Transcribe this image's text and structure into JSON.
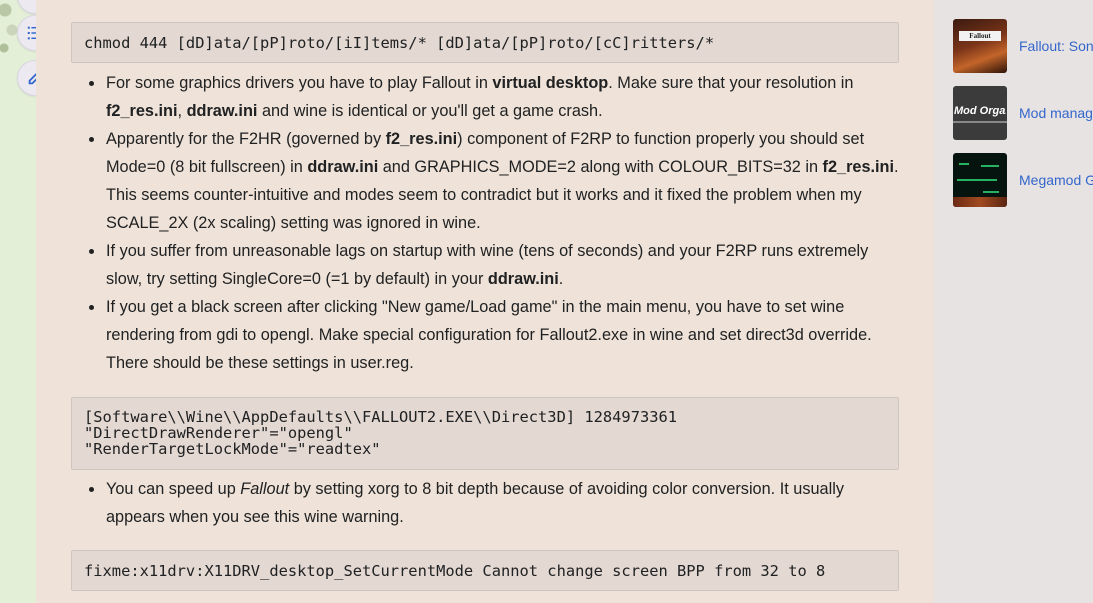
{
  "sidebar_buttons": [
    {
      "name": "toc",
      "icon": "list-icon"
    },
    {
      "name": "edit",
      "icon": "pencil-icon"
    }
  ],
  "code_blocks": {
    "chmod": "chmod 444 [dD]ata/[pP]roto/[iI]tems/* [dD]ata/[pP]roto/[cC]ritters/*",
    "registry_lines": [
      "[Software\\\\Wine\\\\AppDefaults\\\\FALLOUT2.EXE\\\\Direct3D] 1284973361",
      "\"DirectDrawRenderer\"=\"opengl\"",
      "\"RenderTargetLockMode\"=\"readtex\""
    ],
    "fixme": "fixme:x11drv:X11DRV_desktop_SetCurrentMode Cannot change screen BPP from 32 to 8"
  },
  "bullets": {
    "b1": {
      "t1": "For some graphics drivers you have to play Fallout in ",
      "b1": "virtual desktop",
      "t2": ". Make sure that your resolution in ",
      "b2": "f2_res.ini",
      "t3": ", ",
      "b3": "ddraw.ini",
      "t4": " and wine is identical or you'll get a game crash."
    },
    "b2": {
      "t1": "Apparently for the F2HR (governed by ",
      "b1": "f2_res.ini",
      "t2": ") component of F2RP to function properly you should set Mode=0 (8 bit fullscreen) in ",
      "b2": "ddraw.ini",
      "t3": " and GRAPHICS_MODE=2 along with COLOUR_BITS=32 in ",
      "b3": "f2_res.ini",
      "t4": ". This seems counter-intuitive and modes seem to contradict but it works and it fixed the problem when my SCALE_2X (2x scaling) setting was ignored in wine."
    },
    "b3": {
      "t1": "If you suffer from unreasonable lags on startup with wine (tens of seconds) and your F2RP runs extremely slow, try setting SingleCore=0 (=1 by default) in your ",
      "b1": "ddraw.ini",
      "t2": "."
    },
    "b4": {
      "t1": "If you get a black screen after clicking \"New game/Load game\" in the main menu, you have to set wine rendering from gdi to opengl. Make special configuration for Fallout2.exe in wine and set direct3d override. There should be these settings in user.reg."
    },
    "b5": {
      "t1": "You can speed up ",
      "i1": "Fallout",
      "t2": " by setting xorg to 8 bit depth because of avoiding color conversion. It usually appears when you see this wine warning."
    }
  },
  "related": [
    {
      "title": "Fallout: Sonora",
      "thumb_text": "Fallout Sonora"
    },
    {
      "title": "Mod manager",
      "thumb_text": "Mod Organi"
    },
    {
      "title": "Megamod Guide",
      "thumb_text": ""
    }
  ],
  "colors": {
    "link": "#3366cc",
    "page_bg": "#efe3d9",
    "code_bg": "#e3d8d2",
    "sidebar_bg": "#e8e3e3"
  }
}
